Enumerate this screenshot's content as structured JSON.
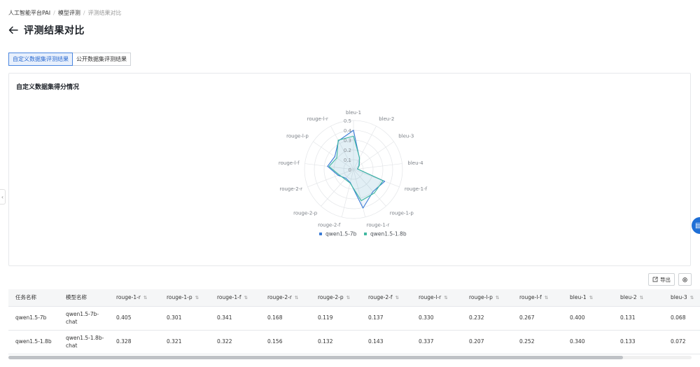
{
  "breadcrumb": [
    "人工智能平台PAI",
    "模型评测",
    "评测结果对比"
  ],
  "page": {
    "title": "评测结果对比"
  },
  "tabs": [
    {
      "label": "自定义数据集评测结果",
      "active": true
    },
    {
      "label": "公开数据集评测结果",
      "active": false
    }
  ],
  "chart_card": {
    "title": "自定义数据集得分情况"
  },
  "chart_data": {
    "type": "radar",
    "axes": [
      "bleu-1",
      "bleu-2",
      "bleu-3",
      "bleu-4",
      "rouge-1-f",
      "rouge-1-p",
      "rouge-1-r",
      "rouge-2-f",
      "rouge-2-p",
      "rouge-2-r",
      "rouge-l-f",
      "rouge-l-p",
      "rouge-l-r"
    ],
    "radial_ticks": [
      "0",
      "0.1",
      "0.2",
      "0.3",
      "0.4",
      "0.5"
    ],
    "rmax": 0.5,
    "series": [
      {
        "name": "qwen1.5-7b",
        "color": "#3a7bd5",
        "values": [
          0.4,
          0.131,
          0.068,
          0.04,
          0.341,
          0.301,
          0.405,
          0.137,
          0.119,
          0.168,
          0.267,
          0.232,
          0.33
        ]
      },
      {
        "name": "qwen1.5-1.8b",
        "color": "#3fb8a0",
        "values": [
          0.34,
          0.133,
          0.072,
          0.042,
          0.322,
          0.321,
          0.328,
          0.143,
          0.132,
          0.156,
          0.252,
          0.207,
          0.337
        ]
      }
    ],
    "legend": "bottom"
  },
  "toolbar": {
    "export_label": "导出"
  },
  "table": {
    "columns": [
      "任务名称",
      "模型名称",
      "rouge-1-r",
      "rouge-1-p",
      "rouge-1-f",
      "rouge-2-r",
      "rouge-2-p",
      "rouge-2-f",
      "rouge-l-r",
      "rouge-l-p",
      "rouge-l-f",
      "bleu-1",
      "bleu-2",
      "bleu-3"
    ],
    "rows": [
      [
        "qwen1.5-7b",
        "qwen1.5-7b-chat",
        "0.405",
        "0.301",
        "0.341",
        "0.168",
        "0.119",
        "0.137",
        "0.330",
        "0.232",
        "0.267",
        "0.400",
        "0.131",
        "0.068"
      ],
      [
        "qwen1.5-1.8b",
        "qwen1.5-1.8b-chat",
        "0.328",
        "0.321",
        "0.322",
        "0.156",
        "0.132",
        "0.143",
        "0.337",
        "0.207",
        "0.252",
        "0.340",
        "0.133",
        "0.072"
      ]
    ]
  }
}
